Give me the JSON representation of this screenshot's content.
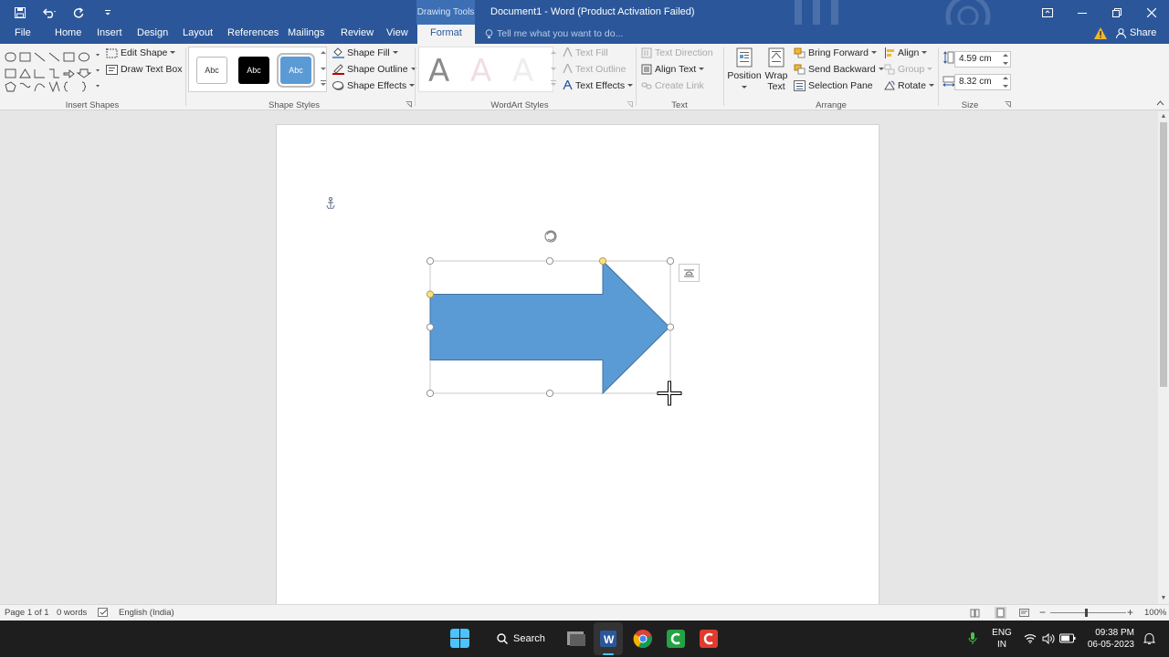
{
  "window": {
    "title": "Document1 - Word (Product Activation Failed)",
    "contextual_group": "Drawing Tools",
    "accent": "#2b579a"
  },
  "tabs": [
    {
      "label": "File"
    },
    {
      "label": "Home"
    },
    {
      "label": "Insert"
    },
    {
      "label": "Design"
    },
    {
      "label": "Layout"
    },
    {
      "label": "References"
    },
    {
      "label": "Mailings"
    },
    {
      "label": "Review"
    },
    {
      "label": "View"
    },
    {
      "label": "Format",
      "active": true
    }
  ],
  "tell_me": "Tell me what you want to do...",
  "share": "Share",
  "ribbon": {
    "insert_shapes": {
      "label": "Insert Shapes",
      "edit_shape": "Edit Shape",
      "draw_text_box": "Draw Text Box"
    },
    "shape_styles": {
      "label": "Shape Styles",
      "presets": [
        "Abc",
        "Abc",
        "Abc"
      ],
      "shape_fill": "Shape Fill",
      "shape_outline": "Shape Outline",
      "shape_effects": "Shape Effects"
    },
    "wordart_styles": {
      "label": "WordArt Styles",
      "letters": [
        "A",
        "A",
        "A"
      ],
      "text_fill": "Text Fill",
      "text_outline": "Text Outline",
      "text_effects": "Text Effects"
    },
    "text": {
      "label": "Text",
      "text_direction": "Text Direction",
      "align_text": "Align Text",
      "create_link": "Create Link"
    },
    "arrange": {
      "label": "Arrange",
      "position": "Position",
      "wrap_text_line1": "Wrap",
      "wrap_text_line2": "Text",
      "bring_forward": "Bring Forward",
      "send_backward": "Send Backward",
      "selection_pane": "Selection Pane",
      "align": "Align",
      "group": "Group",
      "rotate": "Rotate"
    },
    "size": {
      "label": "Size",
      "height": "4.59 cm",
      "width": "8.32 cm"
    }
  },
  "shape": {
    "type": "right-arrow",
    "fill": "#5b9bd5",
    "outline": "#41719c"
  },
  "statusbar": {
    "page": "Page 1 of 1",
    "words": "0 words",
    "language": "English (India)",
    "zoom": "100%"
  },
  "taskbar": {
    "search": "Search",
    "lang_line1": "ENG",
    "lang_line2": "IN",
    "time": "09:38 PM",
    "date": "06-05-2023"
  }
}
